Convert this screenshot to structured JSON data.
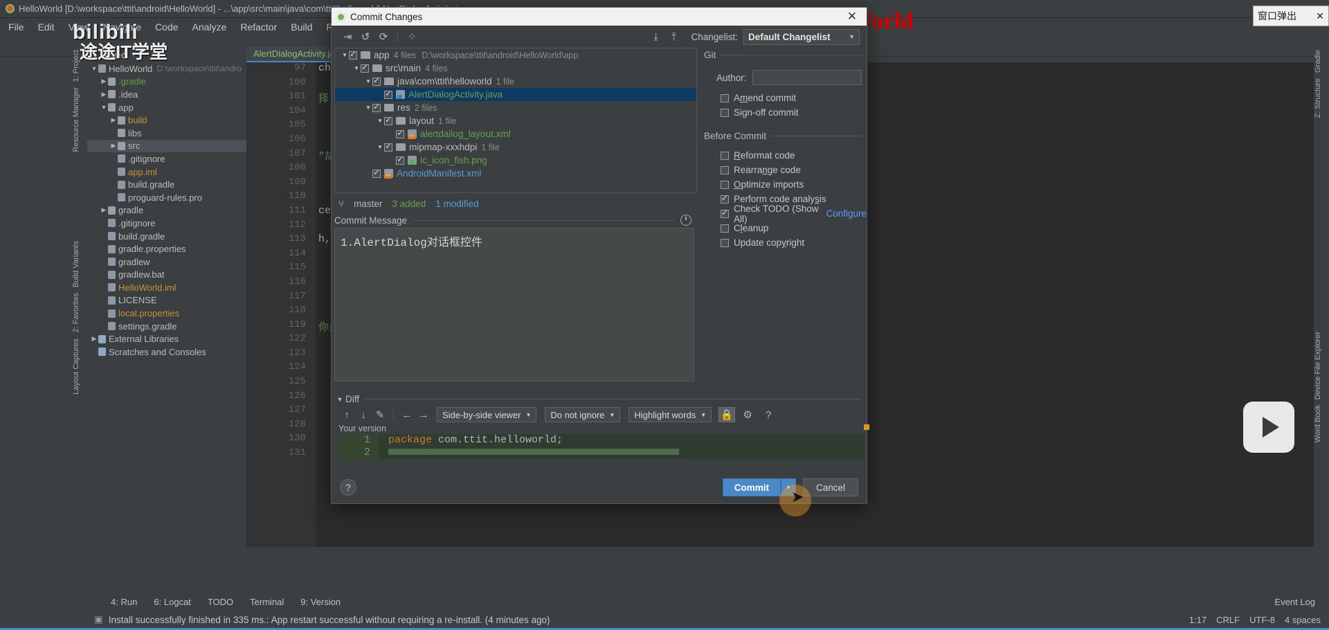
{
  "ide": {
    "window_title": "HelloWorld [D:\\workspace\\ttit\\android\\HelloWorld] - ...\\app\\src\\main\\java\\com\\ttit\\helloworld\\AlertDialogActivity.java",
    "menu": [
      "File",
      "Edit",
      "View",
      "Navigate",
      "Code",
      "Analyze",
      "Refactor",
      "Build",
      "Run"
    ],
    "tab_label": "AlertDialogActivity.java",
    "project_panel_title": "Project",
    "tree": [
      {
        "label": "HelloWorld",
        "meta": "D:\\workspace\\ttit\\andro",
        "depth": 0,
        "arrow": "▼",
        "kind": "module",
        "color": "grey"
      },
      {
        "label": ".gradle",
        "meta": "",
        "depth": 1,
        "arrow": "▶",
        "kind": "folder",
        "color": "green"
      },
      {
        "label": ".idea",
        "meta": "",
        "depth": 1,
        "arrow": "▶",
        "kind": "folder",
        "color": "grey"
      },
      {
        "label": "app",
        "meta": "",
        "depth": 1,
        "arrow": "▼",
        "kind": "folder",
        "color": "grey"
      },
      {
        "label": "build",
        "meta": "",
        "depth": 2,
        "arrow": "▶",
        "kind": "folder",
        "color": "orange"
      },
      {
        "label": "libs",
        "meta": "",
        "depth": 2,
        "arrow": "",
        "kind": "folder",
        "color": "grey"
      },
      {
        "label": "src",
        "meta": "",
        "depth": 2,
        "arrow": "▶",
        "kind": "folder",
        "color": "grey",
        "selected": true
      },
      {
        "label": ".gitignore",
        "meta": "",
        "depth": 2,
        "arrow": "",
        "kind": "file",
        "color": "grey"
      },
      {
        "label": "app.iml",
        "meta": "",
        "depth": 2,
        "arrow": "",
        "kind": "file",
        "color": "orange"
      },
      {
        "label": "build.gradle",
        "meta": "",
        "depth": 2,
        "arrow": "",
        "kind": "file",
        "color": "grey"
      },
      {
        "label": "proguard-rules.pro",
        "meta": "",
        "depth": 2,
        "arrow": "",
        "kind": "file",
        "color": "grey"
      },
      {
        "label": "gradle",
        "meta": "",
        "depth": 1,
        "arrow": "▶",
        "kind": "folder",
        "color": "grey"
      },
      {
        "label": ".gitignore",
        "meta": "",
        "depth": 1,
        "arrow": "",
        "kind": "file",
        "color": "grey"
      },
      {
        "label": "build.gradle",
        "meta": "",
        "depth": 1,
        "arrow": "",
        "kind": "file",
        "color": "grey"
      },
      {
        "label": "gradle.properties",
        "meta": "",
        "depth": 1,
        "arrow": "",
        "kind": "file",
        "color": "grey"
      },
      {
        "label": "gradlew",
        "meta": "",
        "depth": 1,
        "arrow": "",
        "kind": "file",
        "color": "grey"
      },
      {
        "label": "gradlew.bat",
        "meta": "",
        "depth": 1,
        "arrow": "",
        "kind": "file",
        "color": "grey"
      },
      {
        "label": "HelloWorld.iml",
        "meta": "",
        "depth": 1,
        "arrow": "",
        "kind": "file",
        "color": "orange"
      },
      {
        "label": "LICENSE",
        "meta": "",
        "depth": 1,
        "arrow": "",
        "kind": "file",
        "color": "grey"
      },
      {
        "label": "local.properties",
        "meta": "",
        "depth": 1,
        "arrow": "",
        "kind": "file",
        "color": "orange"
      },
      {
        "label": "settings.gradle",
        "meta": "",
        "depth": 1,
        "arrow": "",
        "kind": "file",
        "color": "grey"
      },
      {
        "label": "External Libraries",
        "meta": "",
        "depth": 0,
        "arrow": "▶",
        "kind": "lib",
        "color": "grey"
      },
      {
        "label": "Scratches and Consoles",
        "meta": "",
        "depth": 0,
        "arrow": "",
        "kind": "lib",
        "color": "grey"
      }
    ],
    "gutter_lines": [
      "97",
      "100",
      "101",
      "104",
      "105",
      "106",
      "107",
      "108",
      "109",
      "110",
      "111",
      "112",
      "113",
      "114",
      "115",
      "116",
      "117",
      "118",
      "119",
      "122",
      "123",
      "124",
      "125",
      "126",
      "127",
      "128",
      "130",
      "131"
    ],
    "code_right": [
      "ch) -> {",
      "",
      "择了\" + fruits[which",
      "",
      "",
      "",
      "\"胡椒猪肚鸡\"};",
      "",
      "",
      "",
      "ce.OnMultiChoiceClic",
      "",
      "h, boolean isChecked",
      "",
      "",
      "",
      "",
      "",
      "你点了:\" + result, T"
    ],
    "status_tools": [
      "4: Run",
      "6: Logcat",
      "TODO",
      "Terminal",
      "9: Version"
    ],
    "status_message": "Install successfully finished in 335 ms.: App restart successful without requiring a re-install. (4 minutes ago)",
    "status_right": [
      "1:17",
      "CRLF",
      "UTF-8",
      "4 spaces"
    ],
    "status_event_log": "Event Log",
    "side_labels_left": [
      "1: Project",
      "Resource Manager",
      "Build Variants",
      "2: Favorites",
      "Layout Captures"
    ],
    "side_labels_right": [
      "Gradle",
      "Z: Structure",
      "Device File Explorer",
      "Word Book"
    ]
  },
  "watermarks": {
    "bilibili": "bilibili",
    "tutu": "途途IT学堂",
    "red_banner": "代码下载地址：https://gitee.com/hwdroid/HelloWorld",
    "popup_label": "窗口弹出",
    "popup_close": "✕"
  },
  "dialog": {
    "title": "Commit Changes",
    "close_label": "✕",
    "toolbar": {
      "icons": [
        "collapse-expand-icon",
        "revert-icon",
        "refresh-icon",
        "group-by-icon",
        "expand-all-icon",
        "collapse-all-icon"
      ],
      "changelist_label": "Changelist:",
      "changelist_value": "Default Changelist"
    },
    "file_tree": [
      {
        "depth": 0,
        "tri": "▼",
        "checked": true,
        "icon": "folder",
        "name": "app",
        "color": "grey",
        "meta": "4 files",
        "path": "D:\\workspace\\ttit\\android\\HelloWorld\\app"
      },
      {
        "depth": 1,
        "tri": "▼",
        "checked": true,
        "icon": "folder",
        "name": "src\\main",
        "color": "grey",
        "meta": "4 files",
        "path": ""
      },
      {
        "depth": 2,
        "tri": "▼",
        "checked": true,
        "icon": "folder",
        "name": "java\\com\\ttit\\helloworld",
        "color": "grey",
        "meta": "1 file",
        "path": ""
      },
      {
        "depth": 3,
        "tri": "",
        "checked": true,
        "icon": "java",
        "name": "AlertDialogActivity.java",
        "color": "green",
        "meta": "",
        "path": "",
        "selected": true
      },
      {
        "depth": 2,
        "tri": "▼",
        "checked": true,
        "icon": "folder",
        "name": "res",
        "color": "grey",
        "meta": "2 files",
        "path": ""
      },
      {
        "depth": 3,
        "tri": "▼",
        "checked": true,
        "icon": "folder",
        "name": "layout",
        "color": "grey",
        "meta": "1 file",
        "path": ""
      },
      {
        "depth": 4,
        "tri": "",
        "checked": true,
        "icon": "xml",
        "name": "alertdailog_layout.xml",
        "color": "green",
        "meta": "",
        "path": ""
      },
      {
        "depth": 3,
        "tri": "▼",
        "checked": true,
        "icon": "folder",
        "name": "mipmap-xxxhdpi",
        "color": "grey",
        "meta": "1 file",
        "path": ""
      },
      {
        "depth": 4,
        "tri": "",
        "checked": true,
        "icon": "png",
        "name": "ic_icon_fish.png",
        "color": "green",
        "meta": "",
        "path": ""
      },
      {
        "depth": 2,
        "tri": "",
        "checked": true,
        "icon": "xml",
        "name": "AndroidManifest.xml",
        "color": "blue",
        "meta": "",
        "path": ""
      }
    ],
    "branch": {
      "icon": "branch-icon",
      "name": "master",
      "added": "3 added",
      "modified": "1 modified"
    },
    "commit_message": {
      "label": "Commit Message",
      "value": "1.AlertDialog对话框控件",
      "history_icon": "history-clock-icon"
    },
    "git_group": {
      "title": "Git",
      "author_label": "Author:",
      "author_value": "",
      "checkboxes": [
        {
          "label": "Amend commit",
          "checked": false,
          "mnemonic": "m"
        },
        {
          "label": "Sign-off commit",
          "checked": false,
          "mnemonic": "g"
        }
      ]
    },
    "before_commit_group": {
      "title": "Before Commit",
      "checkboxes": [
        {
          "label": "Reformat code",
          "checked": false,
          "mnemonic": "R"
        },
        {
          "label": "Rearrange code",
          "checked": false,
          "mnemonic": "n"
        },
        {
          "label": "Optimize imports",
          "checked": false,
          "mnemonic": "O"
        },
        {
          "label": "Perform code analysis",
          "checked": true,
          "mnemonic": "s"
        },
        {
          "label": "Check TODO (Show All)",
          "checked": true,
          "mnemonic": "",
          "link": "Configure"
        },
        {
          "label": "Cleanup",
          "checked": false,
          "mnemonic": "l"
        },
        {
          "label": "Update copyright",
          "checked": false,
          "mnemonic": "y"
        }
      ]
    },
    "diff": {
      "section_label": "Diff",
      "buttons": [
        "previous-difference-icon",
        "next-difference-icon",
        "edit-source-icon",
        "apply-left-icon",
        "apply-right-icon"
      ],
      "viewer_select": "Side-by-side viewer",
      "ignore_select": "Do not ignore",
      "highlight_select": "Highlight words",
      "lock_icon": "lock-icon",
      "settings_icon": "gear-icon",
      "help_icon": "question-icon",
      "your_version_label": "Your version",
      "lines": [
        {
          "num": "1",
          "text": "package com.ttit.helloworld;"
        },
        {
          "num": "2",
          "text": ""
        }
      ]
    },
    "footer": {
      "help_label": "?",
      "commit_label": "Commit",
      "commit_caret": "▾",
      "cancel_label": "Cancel"
    }
  }
}
